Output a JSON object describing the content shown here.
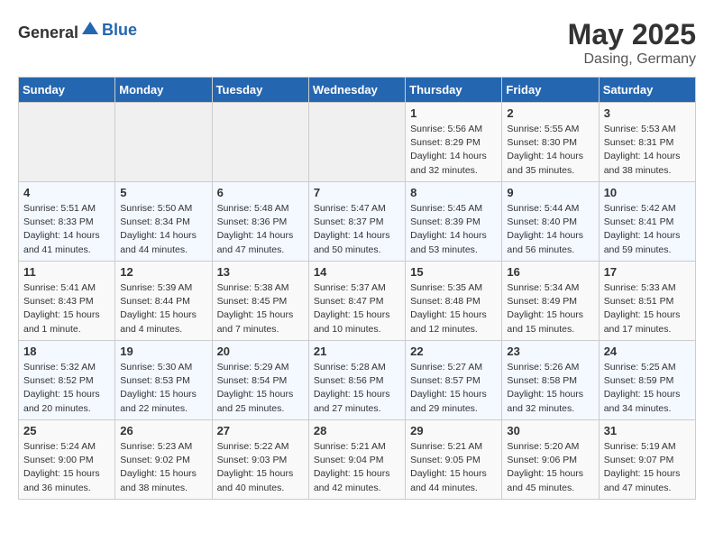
{
  "header": {
    "logo_general": "General",
    "logo_blue": "Blue",
    "month": "May 2025",
    "location": "Dasing, Germany"
  },
  "weekdays": [
    "Sunday",
    "Monday",
    "Tuesday",
    "Wednesday",
    "Thursday",
    "Friday",
    "Saturday"
  ],
  "weeks": [
    [
      {
        "day": "",
        "empty": true
      },
      {
        "day": "",
        "empty": true
      },
      {
        "day": "",
        "empty": true
      },
      {
        "day": "",
        "empty": true
      },
      {
        "day": "1",
        "sunrise": "5:56 AM",
        "sunset": "8:29 PM",
        "daylight": "14 hours and 32 minutes."
      },
      {
        "day": "2",
        "sunrise": "5:55 AM",
        "sunset": "8:30 PM",
        "daylight": "14 hours and 35 minutes."
      },
      {
        "day": "3",
        "sunrise": "5:53 AM",
        "sunset": "8:31 PM",
        "daylight": "14 hours and 38 minutes."
      }
    ],
    [
      {
        "day": "4",
        "sunrise": "5:51 AM",
        "sunset": "8:33 PM",
        "daylight": "14 hours and 41 minutes."
      },
      {
        "day": "5",
        "sunrise": "5:50 AM",
        "sunset": "8:34 PM",
        "daylight": "14 hours and 44 minutes."
      },
      {
        "day": "6",
        "sunrise": "5:48 AM",
        "sunset": "8:36 PM",
        "daylight": "14 hours and 47 minutes."
      },
      {
        "day": "7",
        "sunrise": "5:47 AM",
        "sunset": "8:37 PM",
        "daylight": "14 hours and 50 minutes."
      },
      {
        "day": "8",
        "sunrise": "5:45 AM",
        "sunset": "8:39 PM",
        "daylight": "14 hours and 53 minutes."
      },
      {
        "day": "9",
        "sunrise": "5:44 AM",
        "sunset": "8:40 PM",
        "daylight": "14 hours and 56 minutes."
      },
      {
        "day": "10",
        "sunrise": "5:42 AM",
        "sunset": "8:41 PM",
        "daylight": "14 hours and 59 minutes."
      }
    ],
    [
      {
        "day": "11",
        "sunrise": "5:41 AM",
        "sunset": "8:43 PM",
        "daylight": "15 hours and 1 minute."
      },
      {
        "day": "12",
        "sunrise": "5:39 AM",
        "sunset": "8:44 PM",
        "daylight": "15 hours and 4 minutes."
      },
      {
        "day": "13",
        "sunrise": "5:38 AM",
        "sunset": "8:45 PM",
        "daylight": "15 hours and 7 minutes."
      },
      {
        "day": "14",
        "sunrise": "5:37 AM",
        "sunset": "8:47 PM",
        "daylight": "15 hours and 10 minutes."
      },
      {
        "day": "15",
        "sunrise": "5:35 AM",
        "sunset": "8:48 PM",
        "daylight": "15 hours and 12 minutes."
      },
      {
        "day": "16",
        "sunrise": "5:34 AM",
        "sunset": "8:49 PM",
        "daylight": "15 hours and 15 minutes."
      },
      {
        "day": "17",
        "sunrise": "5:33 AM",
        "sunset": "8:51 PM",
        "daylight": "15 hours and 17 minutes."
      }
    ],
    [
      {
        "day": "18",
        "sunrise": "5:32 AM",
        "sunset": "8:52 PM",
        "daylight": "15 hours and 20 minutes."
      },
      {
        "day": "19",
        "sunrise": "5:30 AM",
        "sunset": "8:53 PM",
        "daylight": "15 hours and 22 minutes."
      },
      {
        "day": "20",
        "sunrise": "5:29 AM",
        "sunset": "8:54 PM",
        "daylight": "15 hours and 25 minutes."
      },
      {
        "day": "21",
        "sunrise": "5:28 AM",
        "sunset": "8:56 PM",
        "daylight": "15 hours and 27 minutes."
      },
      {
        "day": "22",
        "sunrise": "5:27 AM",
        "sunset": "8:57 PM",
        "daylight": "15 hours and 29 minutes."
      },
      {
        "day": "23",
        "sunrise": "5:26 AM",
        "sunset": "8:58 PM",
        "daylight": "15 hours and 32 minutes."
      },
      {
        "day": "24",
        "sunrise": "5:25 AM",
        "sunset": "8:59 PM",
        "daylight": "15 hours and 34 minutes."
      }
    ],
    [
      {
        "day": "25",
        "sunrise": "5:24 AM",
        "sunset": "9:00 PM",
        "daylight": "15 hours and 36 minutes."
      },
      {
        "day": "26",
        "sunrise": "5:23 AM",
        "sunset": "9:02 PM",
        "daylight": "15 hours and 38 minutes."
      },
      {
        "day": "27",
        "sunrise": "5:22 AM",
        "sunset": "9:03 PM",
        "daylight": "15 hours and 40 minutes."
      },
      {
        "day": "28",
        "sunrise": "5:21 AM",
        "sunset": "9:04 PM",
        "daylight": "15 hours and 42 minutes."
      },
      {
        "day": "29",
        "sunrise": "5:21 AM",
        "sunset": "9:05 PM",
        "daylight": "15 hours and 44 minutes."
      },
      {
        "day": "30",
        "sunrise": "5:20 AM",
        "sunset": "9:06 PM",
        "daylight": "15 hours and 45 minutes."
      },
      {
        "day": "31",
        "sunrise": "5:19 AM",
        "sunset": "9:07 PM",
        "daylight": "15 hours and 47 minutes."
      }
    ]
  ]
}
